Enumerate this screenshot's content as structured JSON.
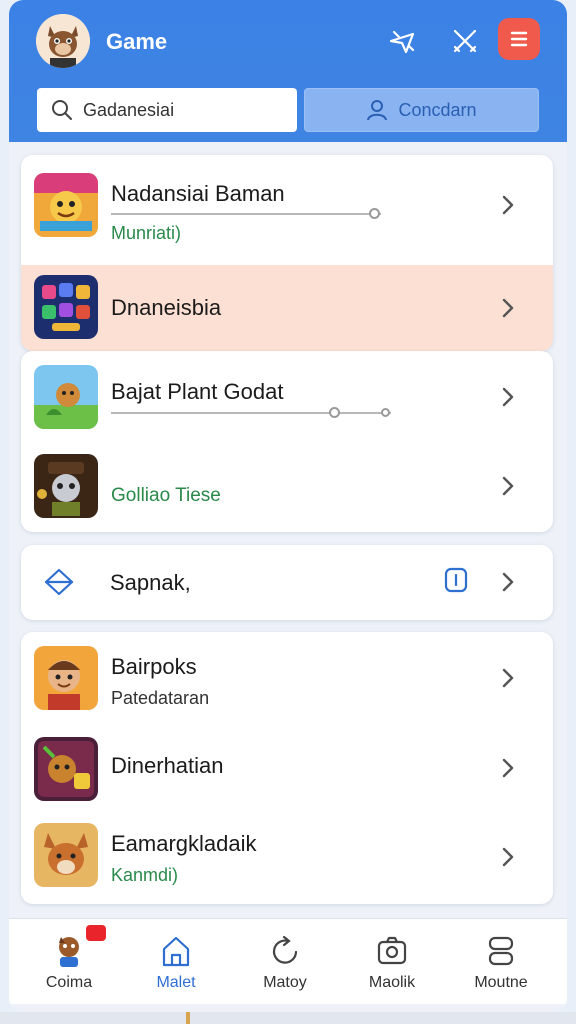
{
  "header": {
    "title": "Game",
    "search_placeholder": "Gadanesiai",
    "condition_button": "Concdarn"
  },
  "sections": [
    {
      "items": [
        {
          "title": "Nadansiai Baman",
          "subtitle": "Munriati)",
          "progress": 0.93
        },
        {
          "title": "Dnaneisbia",
          "highlighted": true
        }
      ]
    },
    {
      "items": [
        {
          "title": "Bajat Plant Godat",
          "progress": 0.79
        },
        {
          "title": "",
          "subtitle": "Golliao Tiese"
        }
      ]
    },
    {
      "items": [
        {
          "title": "Sapnak,"
        }
      ]
    },
    {
      "items": [
        {
          "title": "Bairpoks",
          "subtitle": "Patedataran"
        },
        {
          "title": "Dinerhatian"
        },
        {
          "title": "Eamargkladaik",
          "subtitle": "Kanmdi)"
        }
      ]
    }
  ],
  "nav": [
    {
      "label": "Coima",
      "badge": true
    },
    {
      "label": "Malet",
      "active": true
    },
    {
      "label": "Matoy"
    },
    {
      "label": "Maolik"
    },
    {
      "label": "Moutne"
    }
  ],
  "colors": {
    "header_bg": "#3c82e6",
    "accent": "#2f6fd1",
    "menu_button": "#ef5a4c",
    "subtitle_green": "#2a8a4a",
    "highlight_row": "#fde0d4"
  },
  "icons": {
    "app_avatar": "squirrel-avatar-icon",
    "header_icon_1": "airplane-tools-icon",
    "header_icon_2": "crossed-swords-icon",
    "menu": "hamburger-menu-icon",
    "search": "search-icon",
    "user": "user-icon"
  }
}
